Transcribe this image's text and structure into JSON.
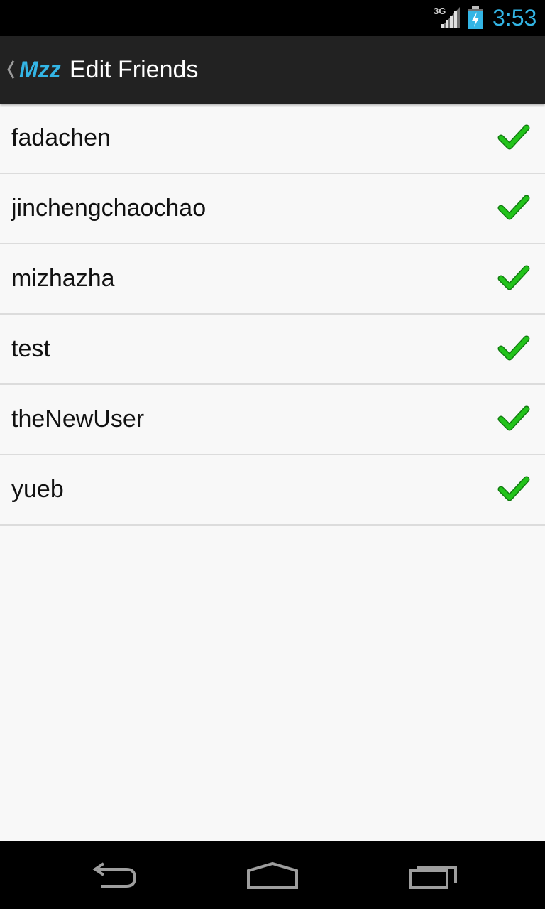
{
  "status_bar": {
    "network": "3G",
    "time": "3:53",
    "icons": [
      "signal-icon",
      "battery-charging-icon"
    ]
  },
  "action_bar": {
    "app_name": "Mzz",
    "title": "Edit Friends",
    "up_icon": "chevron-left-icon"
  },
  "friends": [
    {
      "label": "fadachen",
      "checked": true
    },
    {
      "label": "jinchengchaochao",
      "checked": true
    },
    {
      "label": "mizhazha",
      "checked": true
    },
    {
      "label": "test",
      "checked": true
    },
    {
      "label": "theNewUser",
      "checked": true
    },
    {
      "label": "yueb",
      "checked": true
    }
  ],
  "nav_bar": {
    "icons": [
      "back-icon",
      "home-icon",
      "recents-icon"
    ]
  },
  "colors": {
    "accent": "#33b5e5",
    "check": "#22c31a",
    "action_bar": "#222222",
    "background": "#f8f8f8"
  }
}
